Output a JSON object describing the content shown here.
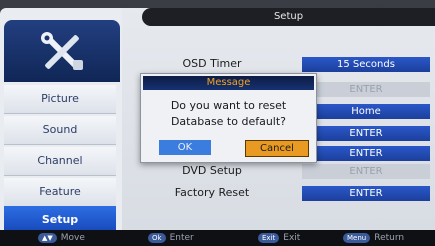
{
  "menu": {
    "title": "Setup",
    "sidebar": [
      {
        "label": "Picture"
      },
      {
        "label": "Sound"
      },
      {
        "label": "Channel"
      },
      {
        "label": "Feature"
      },
      {
        "label": "Setup",
        "active": true
      }
    ],
    "rows": [
      {
        "label": "OSD Timer",
        "value": "15 Seconds"
      },
      {
        "label": "",
        "value": "ENTER"
      },
      {
        "label": "",
        "value": "Home"
      },
      {
        "label": "",
        "value": "ENTER"
      },
      {
        "label": "",
        "value": "ENTER"
      },
      {
        "label": "DVD Setup",
        "value": "ENTER"
      },
      {
        "label": "Factory Reset",
        "value": "ENTER"
      }
    ]
  },
  "dialog": {
    "title": "Message",
    "line1": "Do you want to reset",
    "line2": "Database to default?",
    "ok_label": "OK",
    "cancel_label": "Cancel"
  },
  "footer": [
    {
      "key": "▲▼",
      "label": "Move"
    },
    {
      "key": "Ok",
      "label": "Enter"
    },
    {
      "key": "Exit",
      "label": "Exit"
    },
    {
      "key": "Menu",
      "label": "Return"
    }
  ],
  "colors": {
    "accent": "#1c3f9c",
    "dialog_title_text": "#f3a425",
    "cancel_highlight": "#e89a22"
  }
}
